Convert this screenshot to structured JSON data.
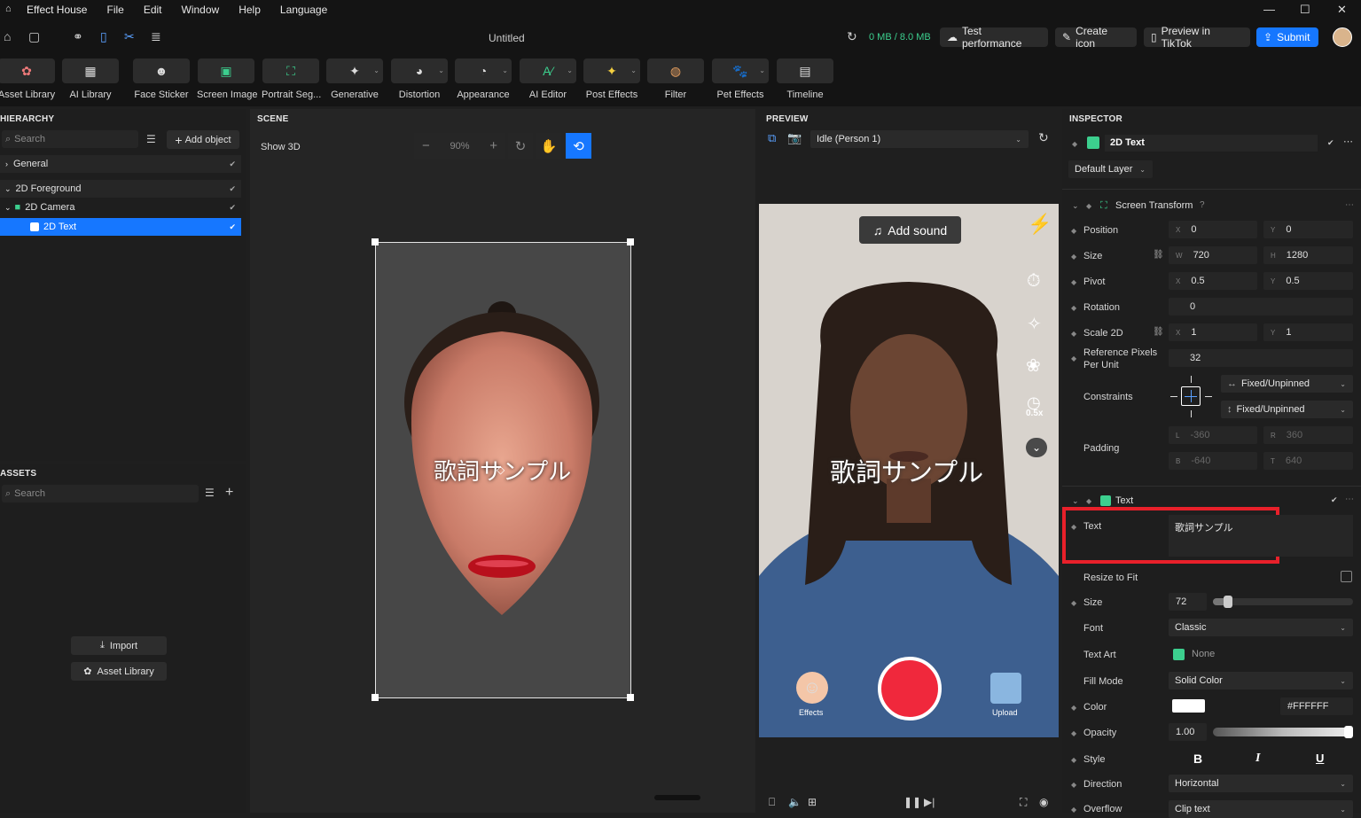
{
  "menu": {
    "app": "Effect House",
    "items": [
      "File",
      "Edit",
      "Window",
      "Help",
      "Language"
    ]
  },
  "doc_title": "Untitled",
  "top": {
    "memory": "0 MB / 8.0 MB",
    "test_perf": "Test performance",
    "create_icon": "Create icon",
    "preview_tiktok": "Preview in TikTok",
    "submit": "Submit"
  },
  "tools": [
    "Asset Library",
    "AI Library",
    "Face Sticker",
    "Screen Image",
    "Portrait Seg...",
    "Generative",
    "Distortion",
    "Appearance",
    "AI Editor",
    "Post Effects",
    "Filter",
    "Pet Effects",
    "Timeline"
  ],
  "hierarchy": {
    "title": "HIERARCHY",
    "search": "Search",
    "add": "Add object",
    "items": [
      "General",
      "2D Foreground",
      "2D Camera",
      "2D Text"
    ]
  },
  "assets": {
    "title": "ASSETS",
    "search": "Search",
    "import": "Import",
    "library": "Asset Library"
  },
  "scene": {
    "title": "SCENE",
    "show3d": "Show 3D",
    "zoom": "90%",
    "overlay_text": "歌詞サンプル"
  },
  "preview": {
    "title": "PREVIEW",
    "animation": "Idle (Person 1)",
    "add_sound": "Add sound",
    "overlay_text": "歌詞サンプル",
    "zoom_badge": "0.5x",
    "effects": "Effects",
    "upload": "Upload"
  },
  "inspector": {
    "title": "INSPECTOR",
    "object": "2D Text",
    "layer": "Default Layer",
    "st_title": "Screen Transform",
    "position": {
      "label": "Position",
      "x": "0",
      "y": "0"
    },
    "size": {
      "label": "Size",
      "w": "720",
      "h": "1280"
    },
    "pivot": {
      "label": "Pivot",
      "x": "0.5",
      "y": "0.5"
    },
    "rotation": {
      "label": "Rotation",
      "v": "0"
    },
    "scale": {
      "label": "Scale 2D",
      "x": "1",
      "y": "1"
    },
    "rppu": {
      "label1": "Reference Pixels",
      "label2": "Per Unit",
      "v": "32"
    },
    "constraints": {
      "label": "Constraints",
      "h": "Fixed/Unpinned",
      "v": "Fixed/Unpinned"
    },
    "padding": {
      "label": "Padding",
      "l": "-360",
      "r": "360",
      "b": "-640",
      "t": "640"
    },
    "text_title": "Text",
    "text": {
      "label": "Text",
      "value": "歌詞サンプル"
    },
    "resize": "Resize to Fit",
    "fsize": {
      "label": "Size",
      "v": "72"
    },
    "font": {
      "label": "Font",
      "v": "Classic"
    },
    "textart": {
      "label": "Text Art",
      "v": "None"
    },
    "fill": {
      "label": "Fill Mode",
      "v": "Solid Color"
    },
    "color": {
      "label": "Color",
      "v": "#FFFFFF"
    },
    "opacity": {
      "label": "Opacity",
      "v": "1.00"
    },
    "style": {
      "label": "Style",
      "b": "B",
      "i": "I",
      "u": "U"
    },
    "direction": {
      "label": "Direction",
      "v": "Horizontal"
    },
    "overflow": {
      "label": "Overflow",
      "v": "Clip text"
    }
  },
  "colors": {
    "accent": "#1677ff",
    "highlight": "#e8202a",
    "record": "#f0283c"
  }
}
